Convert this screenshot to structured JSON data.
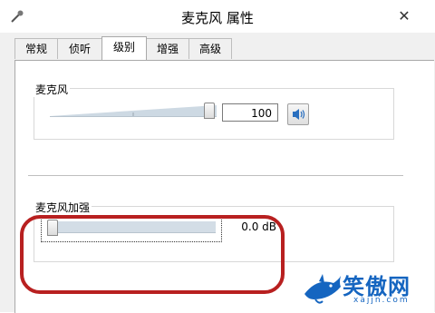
{
  "window": {
    "title": "麦克风 属性",
    "close_glyph": "✕"
  },
  "tabs": [
    {
      "label": "常规",
      "active": false
    },
    {
      "label": "侦听",
      "active": false
    },
    {
      "label": "级别",
      "active": true
    },
    {
      "label": "增强",
      "active": false
    },
    {
      "label": "高级",
      "active": false
    }
  ],
  "microphone": {
    "label": "麦克风",
    "value": "100",
    "level_fraction": 1.0
  },
  "boost": {
    "label": "麦克风加强",
    "value": "0.0 dB",
    "level_fraction": 0.0
  },
  "watermark": {
    "text": "笑傲网",
    "url": "xajjn.com"
  },
  "colors": {
    "highlight": "#b82020",
    "accent": "#1565c0"
  },
  "icons": {
    "speaker_button": "speaker-icon",
    "app": "microphone-app-icon",
    "watermark_logo": "shark-logo"
  }
}
